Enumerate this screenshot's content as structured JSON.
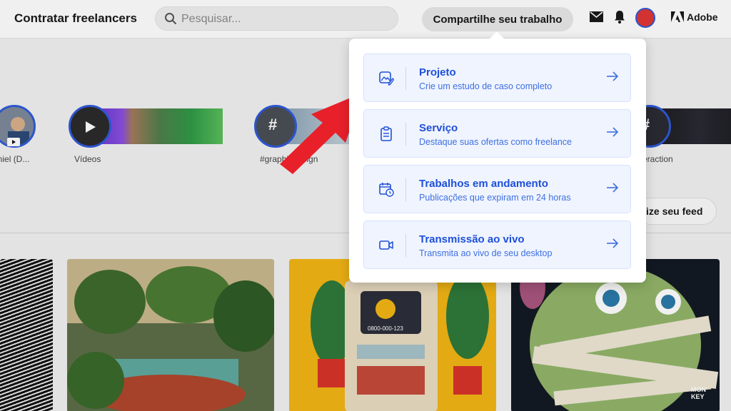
{
  "header": {
    "hire_label": "Contratar freelancers",
    "search_placeholder": "Pesquisar...",
    "share_label": "Compartilhe seu trabalho",
    "adobe_label": "Adobe"
  },
  "stories": [
    {
      "label": "aniel (D..."
    },
    {
      "label": "Vídeos"
    },
    {
      "label": "#graphicdesign"
    },
    {
      "label": "eraction"
    }
  ],
  "feed": {
    "customize_label": "ize seu feed"
  },
  "dropdown": {
    "options": [
      {
        "title": "Projeto",
        "subtitle": "Crie um estudo de caso completo",
        "icon": "image-edit-icon"
      },
      {
        "title": "Serviço",
        "subtitle": "Destaque suas ofertas como freelance",
        "icon": "clipboard-icon"
      },
      {
        "title": "Trabalhos em andamento",
        "subtitle": "Publicações que expiram em 24 horas",
        "icon": "calendar-clock-icon"
      },
      {
        "title": "Transmissão ao vivo",
        "subtitle": "Transmita ao vivo de seu desktop",
        "icon": "video-camera-icon"
      }
    ]
  },
  "thumbs": {
    "tv_text": "0800-000-123",
    "monkey_text": "MON KEY"
  },
  "colors": {
    "accent": "#1e4fd8",
    "option_bg": "#eff4ff",
    "story_ring": "#2f5adb",
    "annotation_arrow": "#e8202a"
  }
}
